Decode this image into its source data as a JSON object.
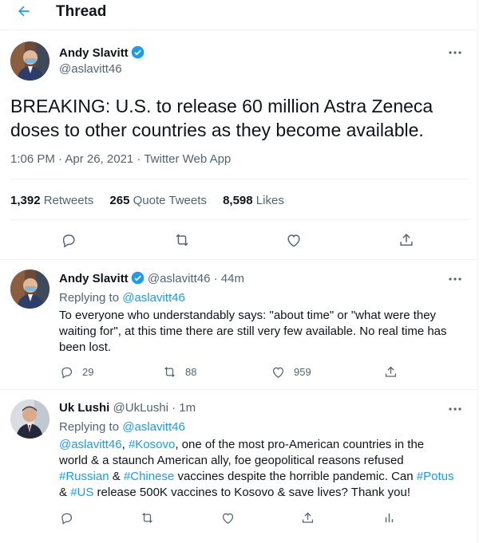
{
  "header": {
    "title": "Thread"
  },
  "colors": {
    "accent": "#1d9bf0",
    "text": "#0f1419",
    "secondary": "#536471",
    "border": "#eff3f4"
  },
  "main_tweet": {
    "author_name": "Andy Slavitt",
    "author_handle": "@aslavitt46",
    "verified": true,
    "text": "BREAKING: U.S. to release 60 million Astra Zeneca doses to other countries as they become available.",
    "meta": "1:06 PM · Apr 26, 2021 · Twitter Web App",
    "stats": {
      "retweets": "1,392",
      "retweets_label": "Retweets",
      "quotes": "265",
      "quotes_label": "Quote Tweets",
      "likes": "8,598",
      "likes_label": "Likes"
    },
    "actions": [
      "reply-icon",
      "retweet-icon",
      "like-icon",
      "share-icon"
    ]
  },
  "reply1": {
    "author_name": "Andy Slavitt",
    "author_handle": "@aslavitt46",
    "time": "· 44m",
    "verified": true,
    "replying_label": "Replying to",
    "replying_to": "@aslavitt46",
    "text_lines": [
      "To everyone who understandably says: \"about time\" or \"what were they",
      "waiting for\", at this time there are still very few available. No real time has",
      "been lost."
    ],
    "reply_count": "29",
    "retweet_count": "88",
    "like_count": "959"
  },
  "reply2": {
    "author_name": "Uk Lushi",
    "author_handle": "@UkLushi",
    "time": "· 1m",
    "replying_label": "Replying to",
    "replying_to": "@aslavitt46",
    "text": {
      "l1_mention": "@aslavitt46",
      "l1_sep": ", ",
      "l1_tag": "#Kosovo",
      "l1_rest": ", one of the most pro-American countries in the",
      "l2": "world & a staunch American ally, foe geopolitical reasons refused",
      "l3_tag1": "#Russian",
      "l3_amp": " & ",
      "l3_tag2": "#Chinese",
      "l3_mid": " vaccines despite the horrible pandemic. Can ",
      "l3_tag3": "#Potus",
      "l4_amp": "& ",
      "l4_tag": "#US",
      "l4_rest": " release 500K vaccines to Kosovo & save lives? Thank you!"
    }
  }
}
